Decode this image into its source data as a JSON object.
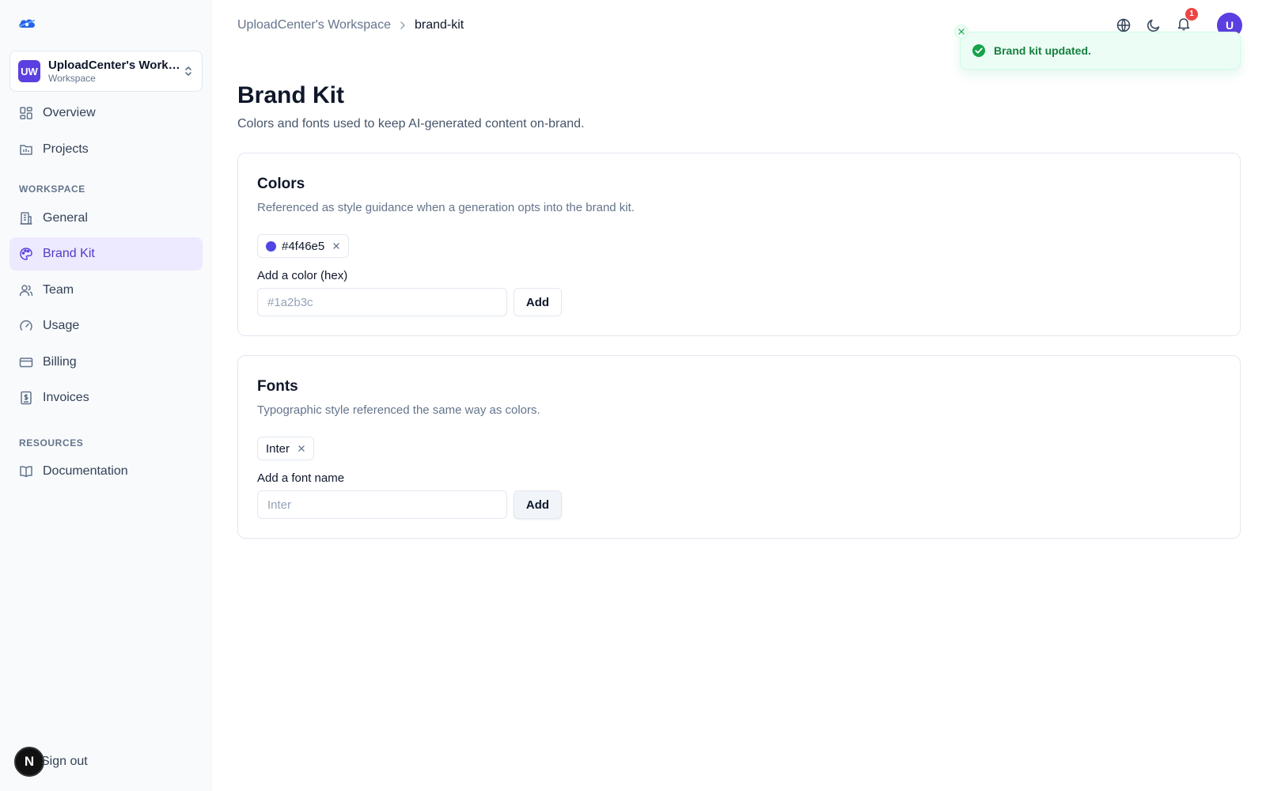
{
  "sidebar": {
    "logo_icon": "cloud-logo-icon",
    "workspace": {
      "initials": "UW",
      "name": "UploadCenter's Workspace",
      "type": "Workspace"
    },
    "nav": [
      {
        "label": "Overview",
        "icon": "overview-grid-icon"
      },
      {
        "label": "Projects",
        "icon": "projects-folder-icon"
      }
    ],
    "workspace_section": {
      "label": "WORKSPACE",
      "items": [
        {
          "label": "General",
          "icon": "building-icon"
        },
        {
          "label": "Brand Kit",
          "icon": "palette-icon",
          "active": true
        },
        {
          "label": "Team",
          "icon": "users-icon"
        },
        {
          "label": "Usage",
          "icon": "gauge-icon"
        },
        {
          "label": "Billing",
          "icon": "credit-card-icon"
        },
        {
          "label": "Invoices",
          "icon": "receipt-icon"
        }
      ]
    },
    "resources_section": {
      "label": "RESOURCES",
      "items": [
        {
          "label": "Documentation",
          "icon": "book-icon"
        }
      ]
    },
    "signout": {
      "badge": "N",
      "label": "Sign out"
    }
  },
  "header": {
    "breadcrumb": {
      "parent": "UploadCenter's Workspace",
      "current": "brand-kit"
    },
    "notification_count": "1",
    "user_initial": "U"
  },
  "toast": {
    "message": "Brand kit updated.",
    "status_color": "#16a34a"
  },
  "page": {
    "title": "Brand Kit",
    "description": "Colors and fonts used to keep AI-generated content on-brand."
  },
  "colors_card": {
    "title": "Colors",
    "description": "Referenced as style guidance when a generation opts into the brand kit.",
    "chips": [
      {
        "value": "#4f46e5",
        "swatch": "#4f46e5"
      }
    ],
    "field_label": "Add a color (hex)",
    "input_value": "",
    "input_placeholder": "#1a2b3c",
    "add_label": "Add"
  },
  "fonts_card": {
    "title": "Fonts",
    "description": "Typographic style referenced the same way as colors.",
    "chips": [
      {
        "value": "Inter"
      }
    ],
    "field_label": "Add a font name",
    "input_value": "",
    "input_placeholder": "Inter",
    "add_label": "Add"
  },
  "theme": {
    "accent": "#5b3fe0",
    "active_nav_bg": "#ede9fe"
  }
}
